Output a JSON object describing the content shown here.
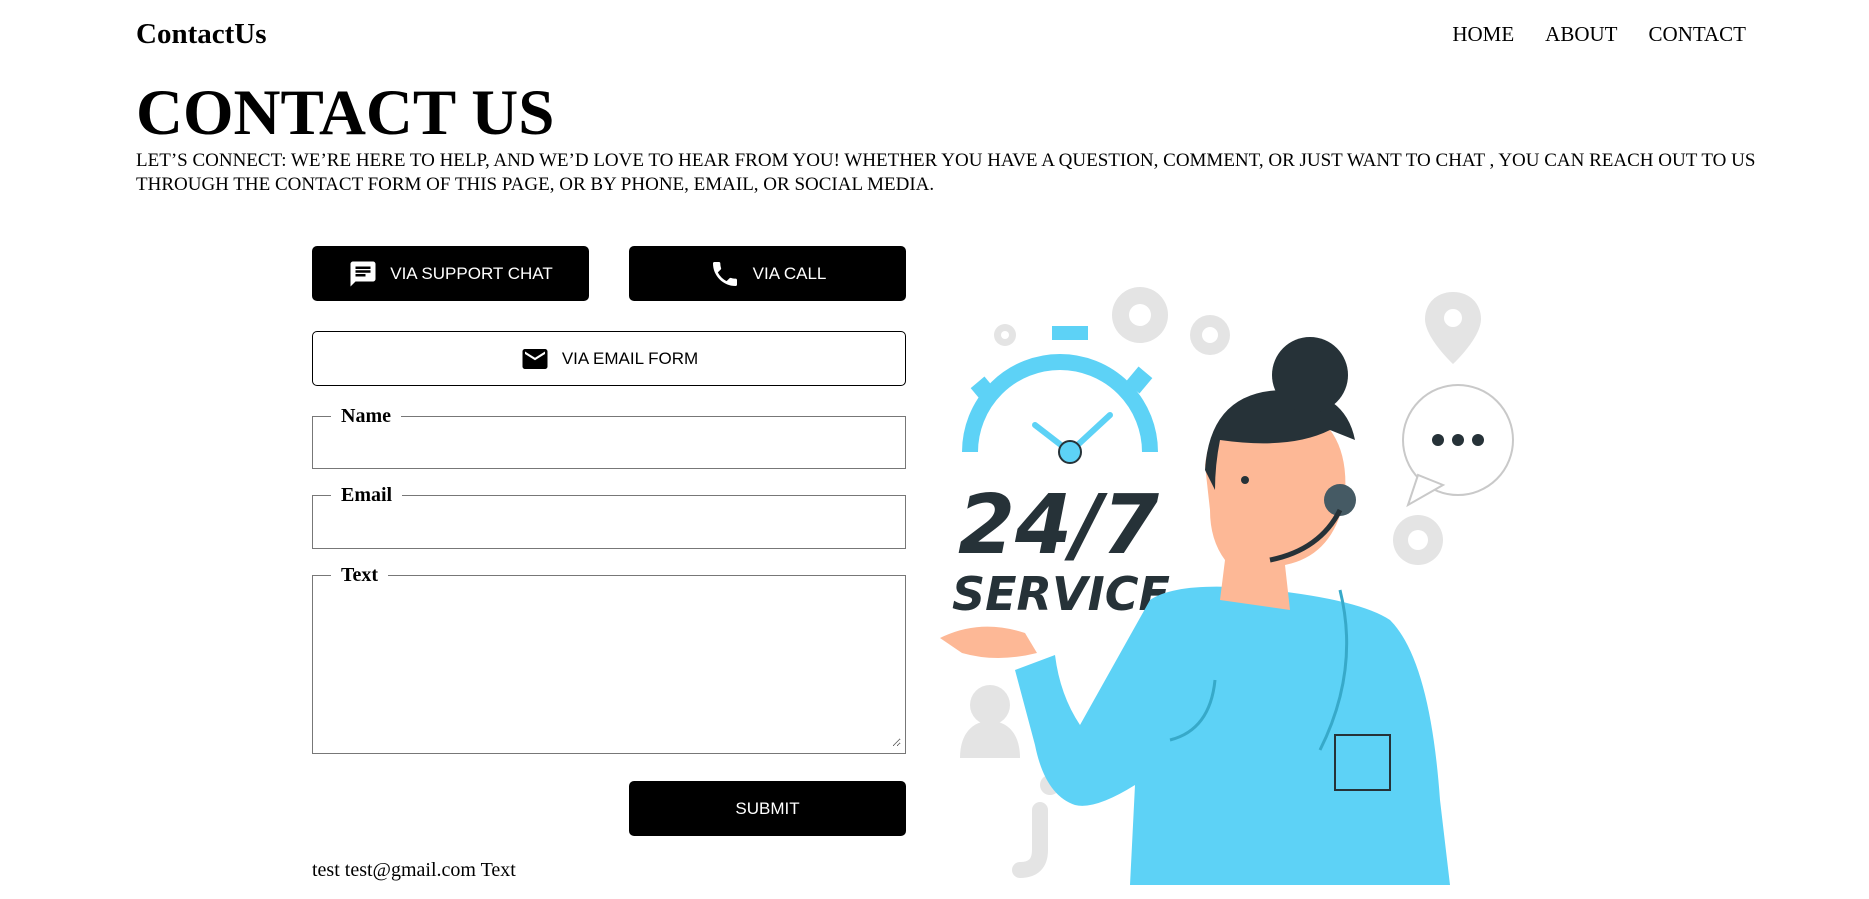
{
  "navbar": {
    "logo": "ContactUs",
    "links": [
      "HOME",
      "ABOUT",
      "CONTACT"
    ]
  },
  "page": {
    "title": "CONTACT US",
    "intro": "LET’S CONNECT: WE’RE HERE TO HELP, AND WE’D LOVE TO HEAR FROM YOU! WHETHER YOU HAVE A QUESTION, COMMENT, OR JUST WANT TO CHAT , YOU CAN REACH OUT TO US THROUGH THE CONTACT FORM OF THIS PAGE, OR BY PHONE, EMAIL, OR SOCIAL MEDIA."
  },
  "contact_methods": {
    "chat": {
      "label": "VIA SUPPORT CHAT",
      "icon": "chat-icon"
    },
    "call": {
      "label": "VIA CALL",
      "icon": "phone-icon"
    },
    "email": {
      "label": "VIA EMAIL FORM",
      "icon": "envelope-icon"
    }
  },
  "form": {
    "name": {
      "legend": "Name",
      "value": ""
    },
    "email": {
      "legend": "Email",
      "value": ""
    },
    "text": {
      "legend": "Text",
      "value": ""
    },
    "submit_label": "SUBMIT"
  },
  "output": "test test@gmail.com Text",
  "illustration": {
    "clock_text": "24/7",
    "service_text": "SERVICE",
    "icon": "customer-support-illustration"
  },
  "colors": {
    "button_dark": "#000000",
    "accent_blue": "#5dd2f6",
    "dark_ink": "#263238",
    "skin": "#fdb896",
    "gray_icons": "#e4e4e4"
  }
}
